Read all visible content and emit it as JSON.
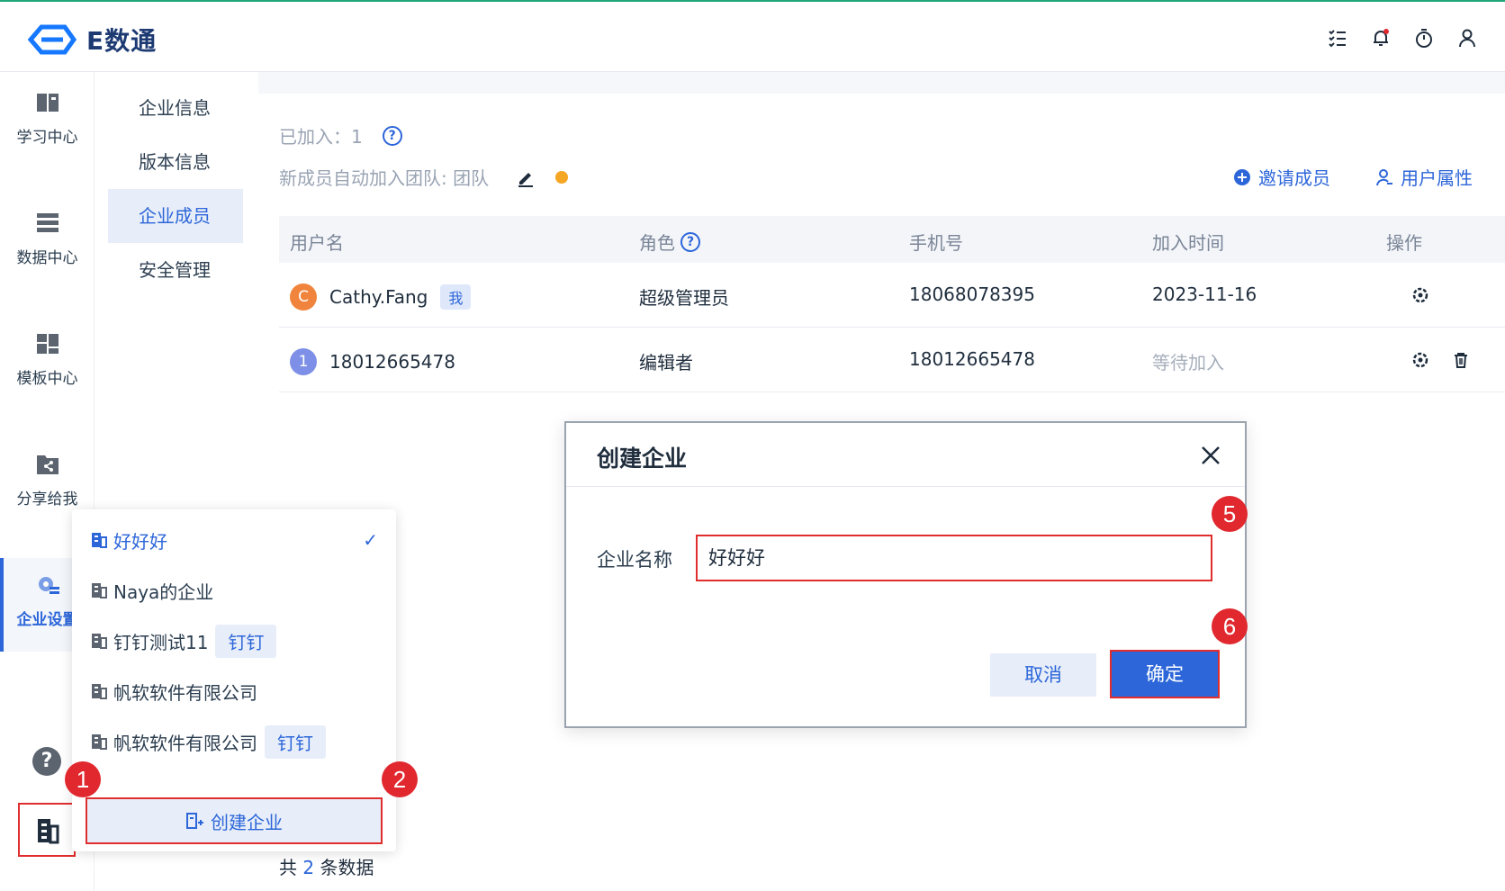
{
  "app": {
    "brand": "E数通"
  },
  "header_icons": [
    "list-check-icon",
    "bell-icon",
    "timer-icon",
    "user-icon"
  ],
  "rail": {
    "items": [
      {
        "label": "学习中心",
        "icon": "book-icon"
      },
      {
        "label": "数据中心",
        "icon": "database-icon"
      },
      {
        "label": "模板中心",
        "icon": "template-icon"
      },
      {
        "label": "分享给我",
        "icon": "share-icon"
      },
      {
        "label": "企业设置",
        "icon": "enterprise-settings-icon",
        "active": true
      }
    ],
    "help_glyph": "?"
  },
  "subnav": {
    "items": [
      {
        "label": "企业信息"
      },
      {
        "label": "版本信息"
      },
      {
        "label": "企业成员",
        "active": true
      },
      {
        "label": "安全管理"
      }
    ]
  },
  "members": {
    "joined_text": "已加入：1",
    "help_glyph": "?",
    "auto_join_text": "新成员自动加入团队: 团队",
    "invite_label": "邀请成员",
    "user_attr_label": "用户属性",
    "columns": [
      "用户名",
      "角色",
      "手机号",
      "加入时间",
      "操作"
    ],
    "rows": [
      {
        "avatar": "C",
        "avatar_color": "#f0843c",
        "name": "Cathy.Fang",
        "badge": "我",
        "role": "超级管理员",
        "phone": "18068078395",
        "joined": "2023-11-16"
      },
      {
        "avatar": "1",
        "avatar_color": "#7d8fe6",
        "name": "18012665478",
        "role": "编辑者",
        "phone": "18012665478",
        "joined": "等待加入"
      }
    ],
    "footer_prefix": "共",
    "footer_count": "2",
    "footer_suffix": "条数据"
  },
  "popover": {
    "items": [
      {
        "label": "好好好",
        "active": true
      },
      {
        "label": "Naya的企业"
      },
      {
        "label": "钉钉测试11",
        "tag": "钉钉"
      },
      {
        "label": "帆软软件有限公司"
      },
      {
        "label": "帆软软件有限公司",
        "tag": "钉钉"
      }
    ],
    "check_glyph": "✓",
    "create_label": "创建企业"
  },
  "dialog": {
    "title": "创建企业",
    "field_label": "企业名称",
    "field_value": "好好好",
    "cancel_label": "取消",
    "ok_label": "确定"
  },
  "markers": [
    "1",
    "2",
    "5",
    "6"
  ],
  "colors": {
    "accent": "#2c66d9",
    "highlight": "#e02d2d",
    "dot": "#f5a623"
  }
}
